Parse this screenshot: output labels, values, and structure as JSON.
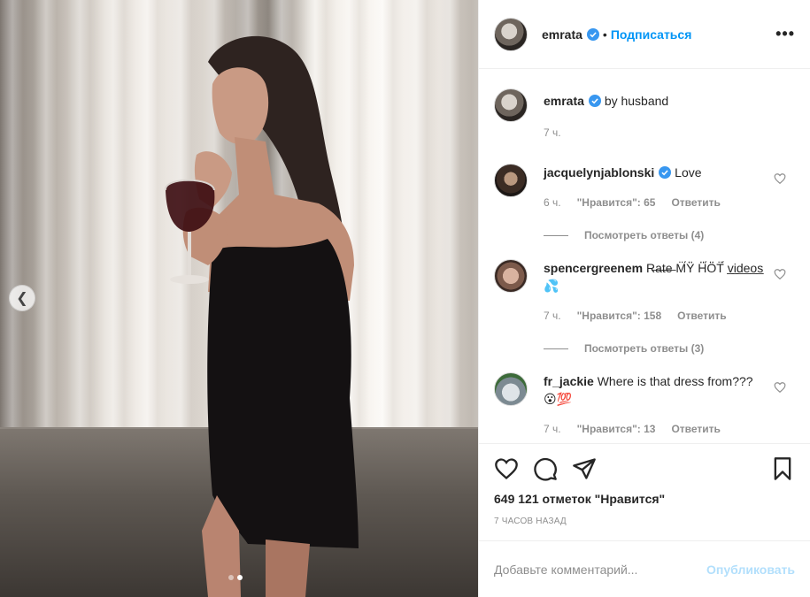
{
  "header": {
    "username": "emrata",
    "separator": "•",
    "follow_label": "Подписаться",
    "more_label": "•••"
  },
  "caption": {
    "username": "emrata",
    "text": "by husband",
    "time": "7 ч."
  },
  "comments": [
    {
      "username": "jacquelynjablonski",
      "verified": true,
      "text": "Love",
      "time": "6 ч.",
      "likes": "\"Нравится\": 65",
      "reply": "Ответить",
      "view_replies": "Посмотреть ответы (4)"
    },
    {
      "username": "spencergreenem",
      "verified": false,
      "text": "R̶a̶t̶e̶ M̈́Ÿ̈ Ḧ̈́Ö̈T̈́ v̲i̲d̲e̲o̲s̲ 💦",
      "time": "7 ч.",
      "likes": "\"Нравится\": 158",
      "reply": "Ответить",
      "view_replies": "Посмотреть ответы (3)"
    },
    {
      "username": "fr_jackie",
      "verified": false,
      "text": "Where is that dress from??? 😮💯",
      "time": "7 ч.",
      "likes": "\"Нравится\": 13",
      "reply": "Ответить"
    }
  ],
  "actions": {
    "likes_text": "649 121 отметок \"Нравится\"",
    "posted_time": "7 ЧАСОВ НАЗАД"
  },
  "add_comment": {
    "placeholder": "Добавьте комментарий...",
    "publish_label": "Опубликовать"
  },
  "carousel": {
    "prev_icon": "chevron-left-icon",
    "dots": 2,
    "active_dot": 2
  },
  "colors": {
    "accent": "#0095f6",
    "publish_disabled": "#b2dffc",
    "verified": "#3897f0",
    "muted": "#8e8e8e"
  }
}
